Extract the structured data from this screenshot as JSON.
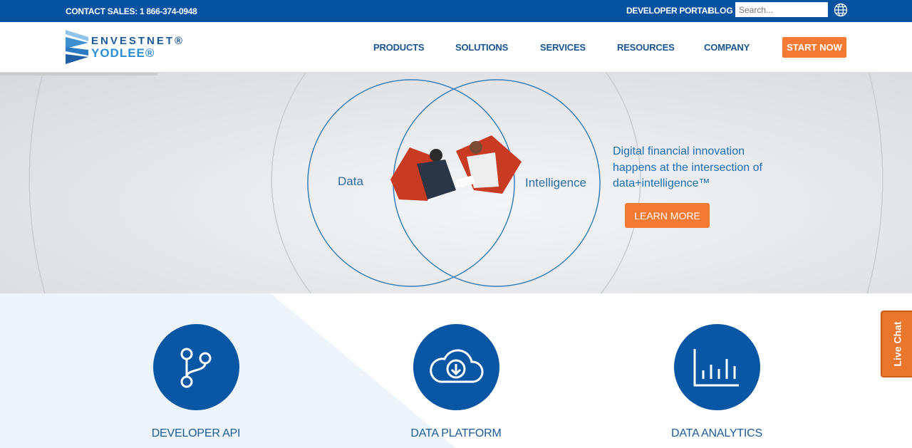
{
  "topbar": {
    "contact": "CONTACT SALES: 1 866-374-0948",
    "developer_portal": "DEVELOPER PORTAL",
    "blog": "BLOG",
    "search_placeholder": "Search..."
  },
  "logo": {
    "line1": "ENVESTNET®",
    "line2": "YODLEE®"
  },
  "nav": {
    "items": [
      "PRODUCTS",
      "SOLUTIONS",
      "SERVICES",
      "RESOURCES",
      "COMPANY"
    ],
    "cta": "START NOW"
  },
  "hero": {
    "left_label": "Data",
    "right_label": "Intelligence",
    "tagline": "Digital financial innovation happens at the intersection of data+intelligence™",
    "button": "LEARN MORE"
  },
  "features": [
    {
      "title": "DEVELOPER API",
      "icon": "git-branch-icon"
    },
    {
      "title": "DATA PLATFORM",
      "icon": "cloud-download-icon"
    },
    {
      "title": "DATA ANALYTICS",
      "icon": "bar-chart-icon"
    }
  ],
  "live_chat": "Live Chat",
  "colors": {
    "brand": "#0553a0",
    "accent": "#f47a33"
  }
}
